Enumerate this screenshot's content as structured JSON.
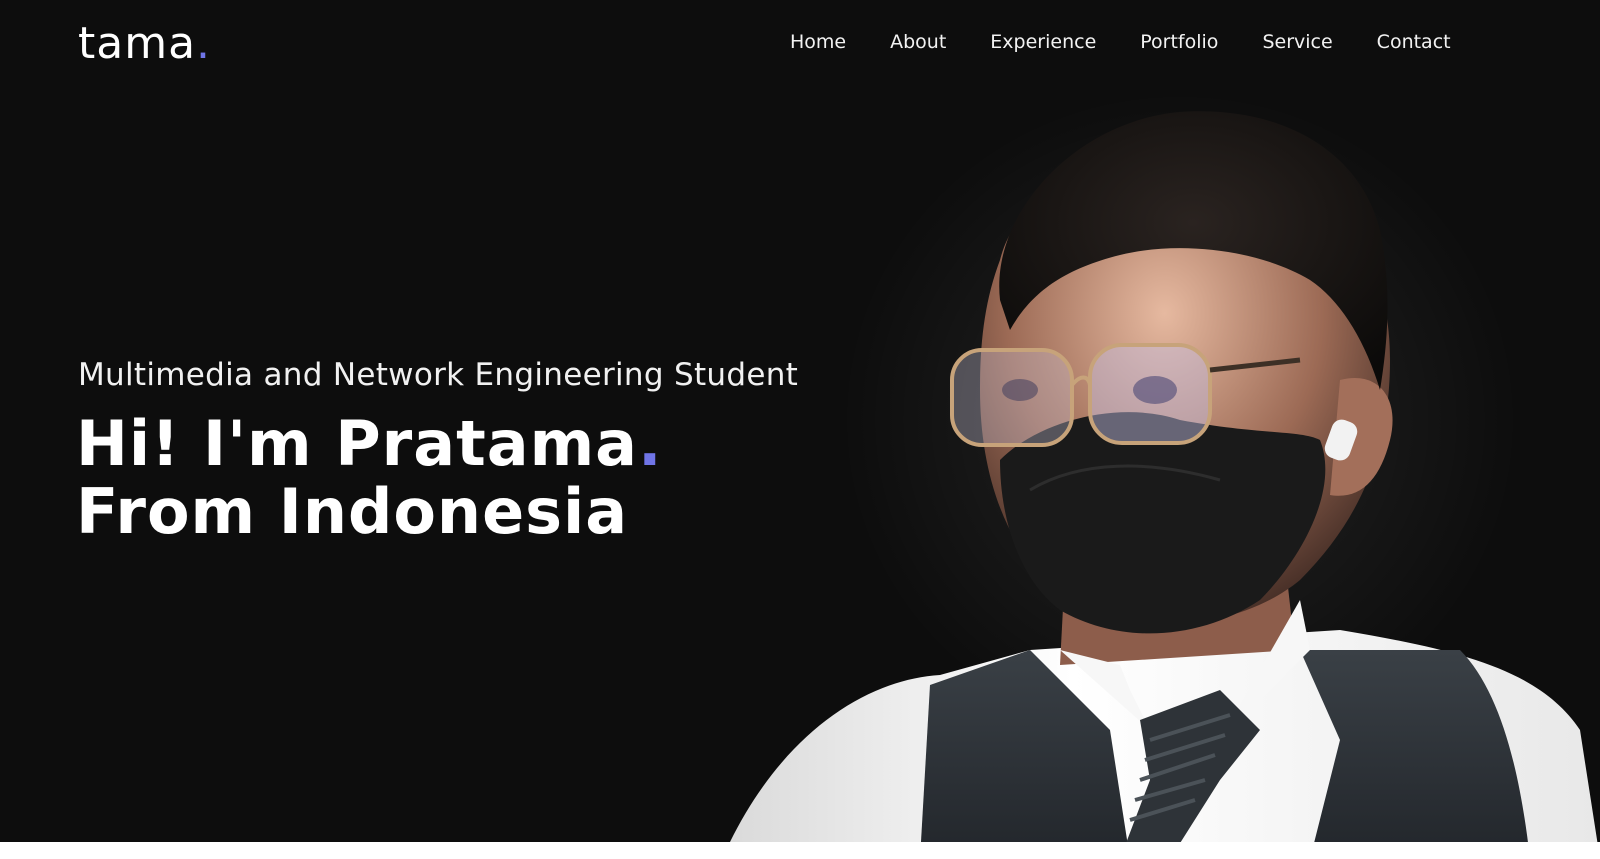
{
  "header": {
    "logo_text": "tama",
    "logo_dot": ".",
    "nav": [
      {
        "label": "Home"
      },
      {
        "label": "About"
      },
      {
        "label": "Experience"
      },
      {
        "label": "Portfolio"
      },
      {
        "label": "Service"
      },
      {
        "label": "Contact"
      }
    ]
  },
  "hero": {
    "subtitle": "Multimedia and Network Engineering Student",
    "greeting": "Hi! I'm Pratama",
    "greeting_dot": ".",
    "location": "From Indonesia"
  },
  "colors": {
    "background": "#0d0d0d",
    "accent": "#6f74e6",
    "text": "#ffffff"
  }
}
